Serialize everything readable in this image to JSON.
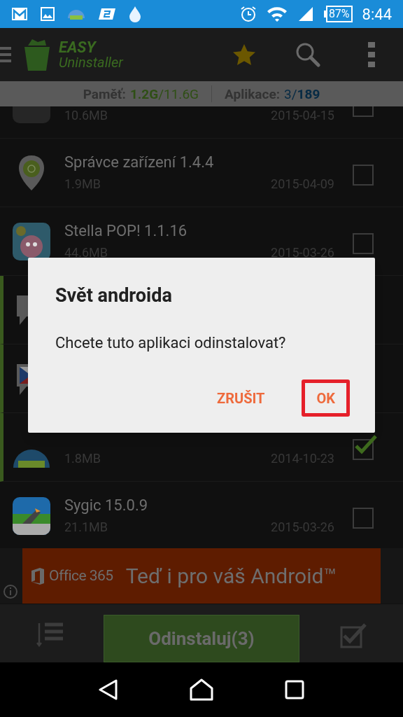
{
  "status_bar": {
    "battery": "87%",
    "time": "8:44"
  },
  "app_bar": {
    "title_top": "EASY",
    "title_bottom": "Uninstaller"
  },
  "info_bar": {
    "memory_label": "Paměť:",
    "memory_value": "**1.2G**/11.6G",
    "apps_label": "Aplikace:",
    "apps_value": "3/**189**"
  },
  "apps": [
    {
      "size": "10.6MB",
      "date": "2015-04-15",
      "selected": false,
      "checked": false
    },
    {
      "name": "Správce zařízení 1.4.4",
      "size": "1.9MB",
      "date": "2015-04-09",
      "selected": false,
      "checked": false
    },
    {
      "name": "Stella POP! 1.1.16",
      "size": "44.6MB",
      "date": "2015-03-26",
      "selected": false,
      "checked": false
    },
    {
      "selected": true
    },
    {
      "selected": true
    },
    {
      "size": "1.8MB",
      "date": "2014-10-23",
      "selected": true,
      "checked": true
    },
    {
      "name": "Sygic 15.0.9",
      "size": "21.1MB",
      "date": "2015-03-26",
      "selected": false,
      "checked": false
    }
  ],
  "ad": {
    "brand": "Office 365",
    "text": "Teď i pro váš Android™"
  },
  "bottom_bar": {
    "uninstall_button": "Odinstaluj(3)"
  },
  "dialog": {
    "title": "Svět androida",
    "message": "Chcete tuto aplikaci odinstalovat?",
    "buttons": [
      {
        "label": "ZRUŠIT",
        "highlighted": false
      },
      {
        "label": "OK",
        "highlighted": true
      }
    ]
  }
}
